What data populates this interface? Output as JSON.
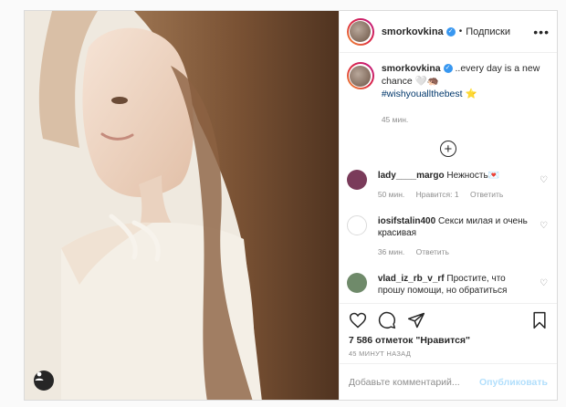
{
  "header": {
    "username": "smorkovkina",
    "separator": "•",
    "follow_label": "Подписки",
    "more": "•••"
  },
  "caption": {
    "username": "smorkovkina",
    "text": " ..every day is a new chance 🤍🦔",
    "hashtag": "#wishyouallthebest",
    "emoji": "⭐",
    "time": "45 мин."
  },
  "comments": [
    {
      "username": "lady____margo",
      "text": "Нежность💌",
      "time": "50 мин.",
      "likes": "Нравится: 1",
      "reply": "Ответить",
      "avatar_color": "#7a3b5a"
    },
    {
      "username": "iosifstalin400",
      "text": "Секси милая и очень красивая",
      "time": "36 мин.",
      "reply": "Ответить",
      "avatar_color": "#ffffff"
    },
    {
      "username": "vlad_iz_rb_v_rf",
      "text": "Простите, что прошу помощи, но обратиться",
      "avatar_color": "#6f8a6a"
    }
  ],
  "post": {
    "likes": "7 586 отметок \"Нравится\"",
    "time": "45 МИНУТ НАЗАД"
  },
  "add_comment": {
    "placeholder": "Добавьте комментарий...",
    "publish": "Опубликовать"
  },
  "colors": {
    "link": "#00376b",
    "muted": "#8e8e8e",
    "verified": "#3897f0",
    "publish_disabled": "#b2dffc"
  }
}
